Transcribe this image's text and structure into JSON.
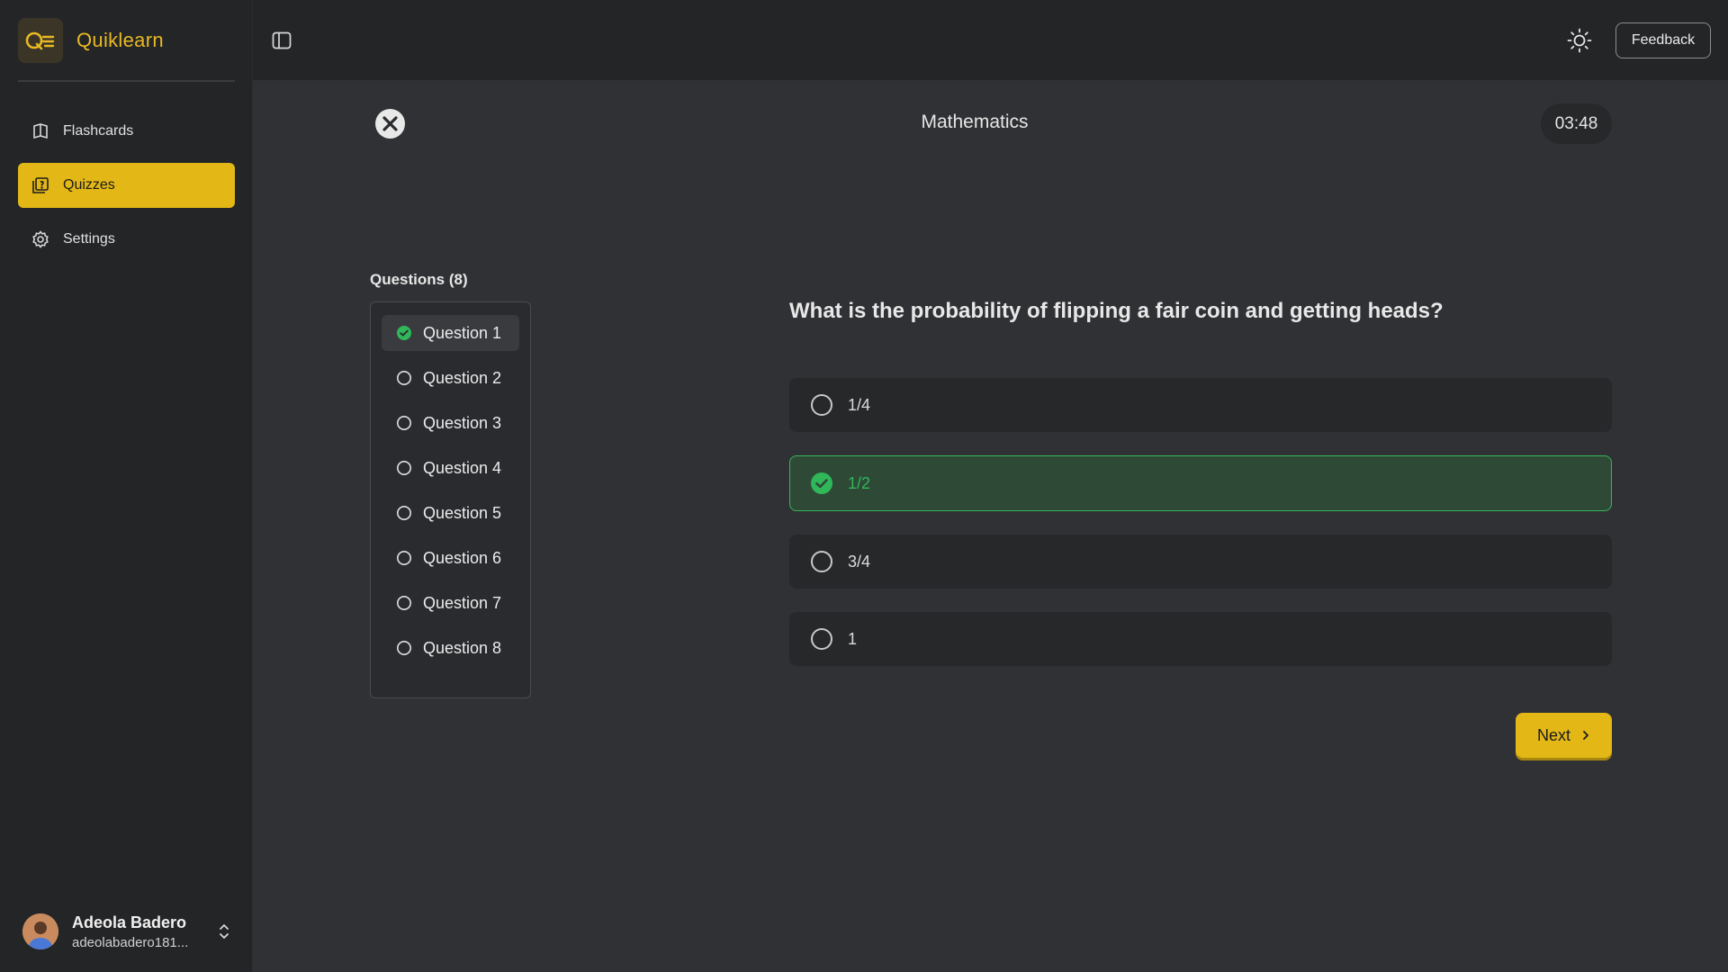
{
  "app": {
    "name": "Quiklearn"
  },
  "sidebar": {
    "items": [
      {
        "label": "Flashcards",
        "icon": "flashcards-icon",
        "active": false
      },
      {
        "label": "Quizzes",
        "icon": "quizzes-icon",
        "active": true
      },
      {
        "label": "Settings",
        "icon": "settings-icon",
        "active": false
      }
    ],
    "user": {
      "name": "Adeola Badero",
      "email": "adeolabadero181..."
    }
  },
  "topbar": {
    "feedback_label": "Feedback"
  },
  "quiz": {
    "title": "Mathematics",
    "timer": "03:48",
    "questions_heading": "Questions (8)",
    "questions": [
      {
        "label": "Question 1",
        "status": "answered",
        "current": true
      },
      {
        "label": "Question 2",
        "status": "unanswered",
        "current": false
      },
      {
        "label": "Question 3",
        "status": "unanswered",
        "current": false
      },
      {
        "label": "Question 4",
        "status": "unanswered",
        "current": false
      },
      {
        "label": "Question 5",
        "status": "unanswered",
        "current": false
      },
      {
        "label": "Question 6",
        "status": "unanswered",
        "current": false
      },
      {
        "label": "Question 7",
        "status": "unanswered",
        "current": false
      },
      {
        "label": "Question 8",
        "status": "unanswered",
        "current": false
      }
    ],
    "question_text": "What is the probability of flipping a fair coin and getting heads?",
    "options": [
      {
        "label": "1/4",
        "selected": false
      },
      {
        "label": "1/2",
        "selected": true
      },
      {
        "label": "3/4",
        "selected": false
      },
      {
        "label": "1",
        "selected": false
      }
    ],
    "next_label": "Next"
  },
  "colors": {
    "accent": "#e2b716",
    "correct": "#2fb75a",
    "background": "#303134",
    "sidebar": "#242527"
  }
}
